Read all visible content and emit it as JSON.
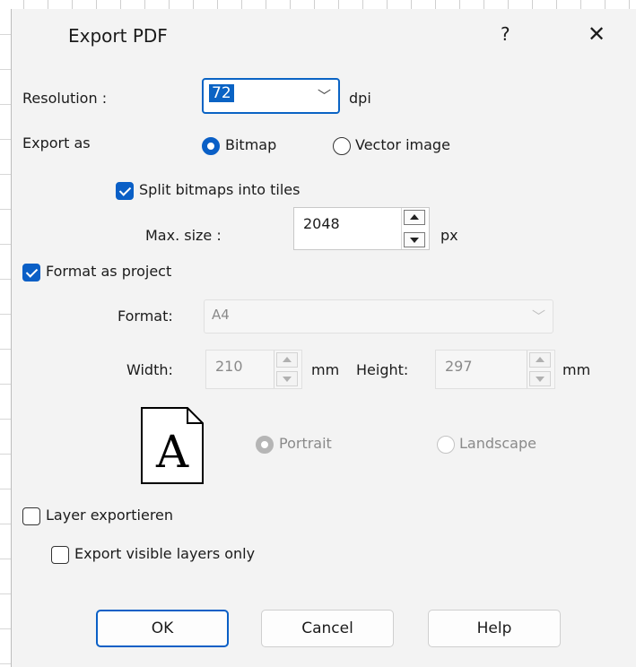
{
  "window": {
    "title": "Export PDF",
    "help_label": "?",
    "close_label": "✕"
  },
  "resolution": {
    "label": "Resolution :",
    "value": "72",
    "unit": "dpi"
  },
  "export_as": {
    "label": "Export as",
    "options": [
      "Bitmap",
      "Vector image"
    ],
    "selected": "Bitmap"
  },
  "split_tiles": {
    "label": "Split bitmaps into tiles",
    "checked": true,
    "max_size_label": "Max. size :",
    "max_size_value": "2048",
    "max_size_unit": "px"
  },
  "format_project": {
    "label": "Format as project",
    "checked": true,
    "format_label": "Format:",
    "format_value": "A4",
    "width_label": "Width:",
    "width_value": "210",
    "width_unit": "mm",
    "height_label": "Height:",
    "height_value": "297",
    "height_unit": "mm",
    "page_glyph": "A",
    "orientation_options": [
      "Portrait",
      "Landscape"
    ],
    "orientation_selected": "Portrait"
  },
  "layer_export": {
    "label": "Layer exportieren",
    "checked": false,
    "visible_only_label": "Export visible layers only",
    "visible_only_checked": false
  },
  "buttons": {
    "ok": "OK",
    "cancel": "Cancel",
    "help": "Help"
  },
  "colors": {
    "accent": "#0a5fc6",
    "background": "#f3f3f3",
    "disabled_text": "#8a8a8a"
  }
}
